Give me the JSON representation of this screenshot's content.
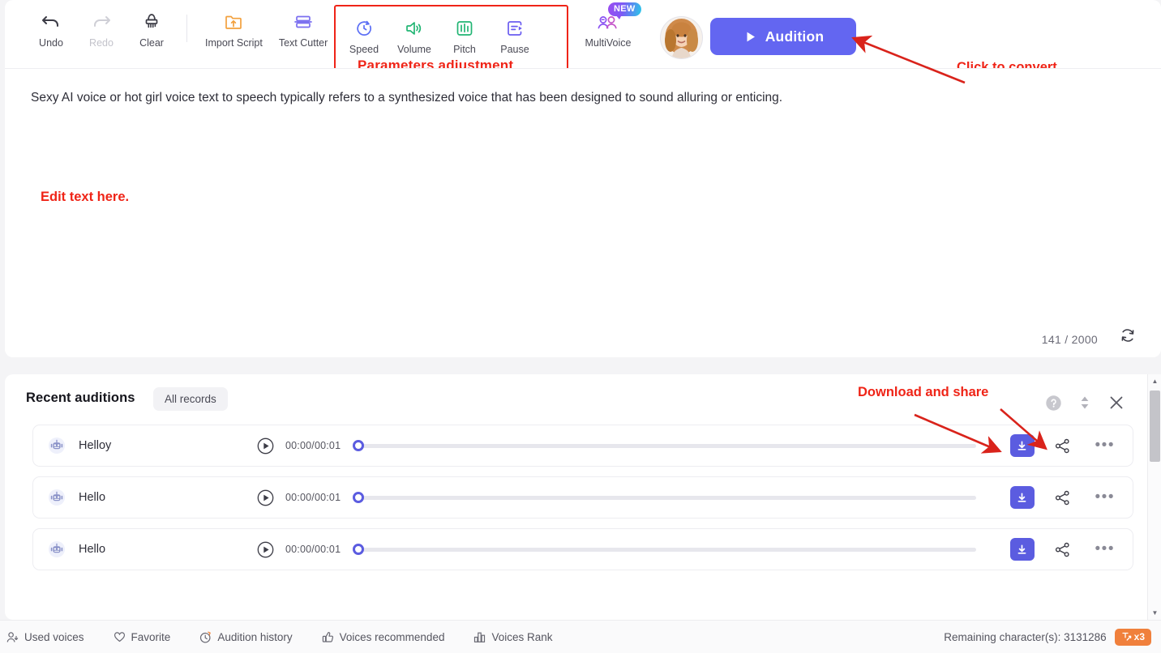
{
  "toolbar": {
    "items": [
      {
        "label": "Undo",
        "icon": "undo-icon",
        "disabled": false
      },
      {
        "label": "Redo",
        "icon": "redo-icon",
        "disabled": true
      },
      {
        "label": "Clear",
        "icon": "brush-icon",
        "disabled": false
      }
    ],
    "file_items": [
      {
        "label": "Import Script",
        "icon": "folder-upload-icon"
      },
      {
        "label": "Text Cutter",
        "icon": "text-cutter-icon"
      }
    ],
    "parameters": [
      {
        "label": "Speed",
        "icon": "speed-clock-icon",
        "color": "#5b6ef5"
      },
      {
        "label": "Volume",
        "icon": "volume-icon",
        "color": "#21b573"
      },
      {
        "label": "Pitch",
        "icon": "pitch-equalizer-icon",
        "color": "#21b573"
      },
      {
        "label": "Pause",
        "icon": "pause-insert-icon",
        "color": "#6a5cf0"
      }
    ],
    "multivoice": {
      "label": "MultiVoice",
      "icon": "multivoice-icon",
      "badge": "NEW"
    },
    "avatar": {
      "icon": "avatar",
      "alt": "voice-avatar"
    },
    "audition_button": {
      "label": "Audition",
      "icon": "play-icon",
      "color": "#6366f1"
    }
  },
  "annotations": {
    "parameters": "Parameters adjustment",
    "click_to_convert": "Click to convert.",
    "edit_text_here": "Edit text here.",
    "download_and_share": "Download and share",
    "color": "#ef2417"
  },
  "editor": {
    "text": "Sexy AI voice or hot girl voice text to speech typically refers to a synthesized voice that has been designed to sound alluring or enticing.",
    "char_count": "141",
    "char_separator": "/",
    "char_limit": "2000",
    "refresh_icon": "refresh-icon"
  },
  "auditions": {
    "title": "Recent auditions",
    "all_records_label": "All records",
    "head_actions": [
      {
        "icon": "help-icon",
        "name": "help"
      },
      {
        "icon": "sort-icon",
        "name": "sort"
      },
      {
        "icon": "close-icon",
        "name": "close"
      }
    ],
    "rows": [
      {
        "name": "Helloy",
        "time": "00:00/00:01",
        "progress": 0,
        "icon": "robot-voice-icon"
      },
      {
        "name": "Hello",
        "time": "00:00/00:01",
        "progress": 0,
        "icon": "robot-voice-icon"
      },
      {
        "name": "Hello",
        "time": "00:00/00:01",
        "progress": 0,
        "icon": "robot-voice-icon"
      }
    ],
    "row_actions": {
      "download": "download-icon",
      "share": "share-icon",
      "more": "more-icon",
      "play": "play-circle-icon"
    },
    "download_color": "#5b5ce0"
  },
  "statusbar": {
    "items": [
      {
        "label": "Used voices",
        "icon": "used-voices-icon"
      },
      {
        "label": "Favorite",
        "icon": "heart-icon"
      },
      {
        "label": "Audition history",
        "icon": "history-icon"
      },
      {
        "label": "Voices recommended",
        "icon": "thumbs-up-icon"
      },
      {
        "label": "Voices Rank",
        "icon": "bar-chart-icon"
      }
    ],
    "remaining_label": "Remaining character(s): 3131286",
    "multiplier_badge": "x3",
    "multiplier_color": "#f0803c"
  }
}
